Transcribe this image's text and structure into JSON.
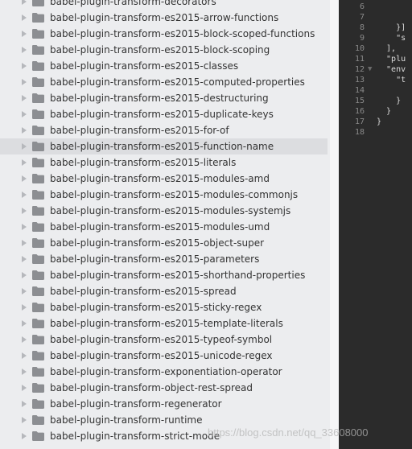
{
  "sidebar": {
    "items": [
      {
        "label": "babel-plugin-transform-decorators"
      },
      {
        "label": "babel-plugin-transform-es2015-arrow-functions"
      },
      {
        "label": "babel-plugin-transform-es2015-block-scoped-functions"
      },
      {
        "label": "babel-plugin-transform-es2015-block-scoping"
      },
      {
        "label": "babel-plugin-transform-es2015-classes"
      },
      {
        "label": "babel-plugin-transform-es2015-computed-properties"
      },
      {
        "label": "babel-plugin-transform-es2015-destructuring"
      },
      {
        "label": "babel-plugin-transform-es2015-duplicate-keys"
      },
      {
        "label": "babel-plugin-transform-es2015-for-of"
      },
      {
        "label": "babel-plugin-transform-es2015-function-name",
        "selected": true
      },
      {
        "label": "babel-plugin-transform-es2015-literals"
      },
      {
        "label": "babel-plugin-transform-es2015-modules-amd"
      },
      {
        "label": "babel-plugin-transform-es2015-modules-commonjs"
      },
      {
        "label": "babel-plugin-transform-es2015-modules-systemjs"
      },
      {
        "label": "babel-plugin-transform-es2015-modules-umd"
      },
      {
        "label": "babel-plugin-transform-es2015-object-super"
      },
      {
        "label": "babel-plugin-transform-es2015-parameters"
      },
      {
        "label": "babel-plugin-transform-es2015-shorthand-properties"
      },
      {
        "label": "babel-plugin-transform-es2015-spread"
      },
      {
        "label": "babel-plugin-transform-es2015-sticky-regex"
      },
      {
        "label": "babel-plugin-transform-es2015-template-literals"
      },
      {
        "label": "babel-plugin-transform-es2015-typeof-symbol"
      },
      {
        "label": "babel-plugin-transform-es2015-unicode-regex"
      },
      {
        "label": "babel-plugin-transform-exponentiation-operator"
      },
      {
        "label": "babel-plugin-transform-object-rest-spread"
      },
      {
        "label": "babel-plugin-transform-regenerator"
      },
      {
        "label": "babel-plugin-transform-runtime"
      },
      {
        "label": "babel-plugin-transform-strict-mode"
      }
    ]
  },
  "editor": {
    "lines": [
      {
        "num": "6",
        "fold": "",
        "text": "      "
      },
      {
        "num": "7",
        "fold": "",
        "text": "      "
      },
      {
        "num": "8",
        "fold": "",
        "text": "    }]"
      },
      {
        "num": "9",
        "fold": "",
        "text": "    \"s"
      },
      {
        "num": "10",
        "fold": "",
        "text": "  ],"
      },
      {
        "num": "11",
        "fold": "",
        "text": "  \"plu"
      },
      {
        "num": "12",
        "fold": "▼",
        "text": "  \"env"
      },
      {
        "num": "13",
        "fold": "",
        "text": "    \"t"
      },
      {
        "num": "14",
        "fold": "",
        "text": "      "
      },
      {
        "num": "15",
        "fold": "",
        "text": "    }"
      },
      {
        "num": "16",
        "fold": "",
        "text": "  }"
      },
      {
        "num": "17",
        "fold": "",
        "text": "}"
      },
      {
        "num": "18",
        "fold": "",
        "text": ""
      }
    ]
  },
  "watermark": {
    "text": "https://blog.csdn.net/qq_33608000"
  },
  "colors": {
    "sidebar_bg": "#ecedef",
    "selected_bg": "#dcdde0",
    "folder": "#8c8e92",
    "editor_bg": "#2b2b2b"
  }
}
